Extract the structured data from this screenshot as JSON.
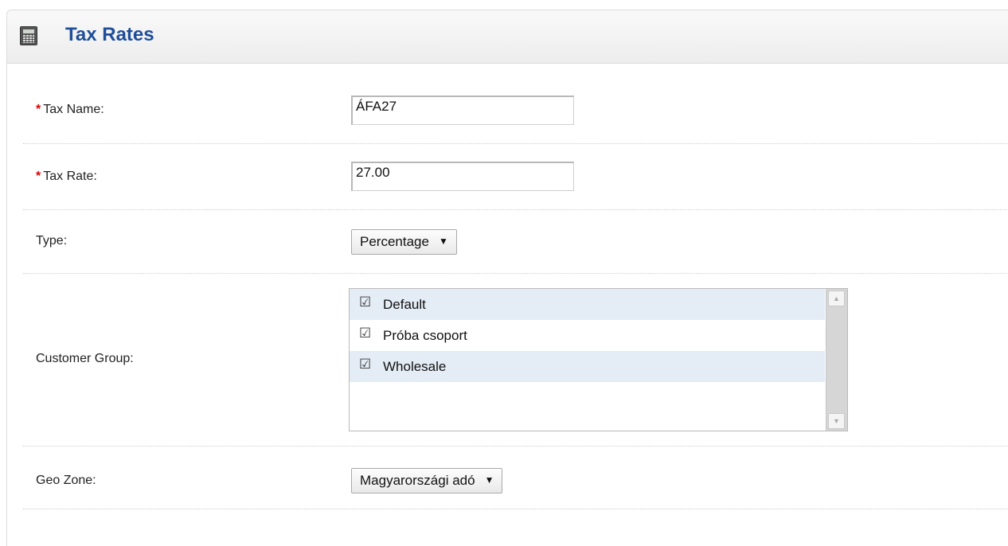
{
  "page": {
    "title": "Tax Rates",
    "icon": "calculator-icon"
  },
  "form": {
    "required_marker": "*",
    "tax_name": {
      "label": "Tax Name:",
      "value": "ÁFA27",
      "required": true
    },
    "tax_rate": {
      "label": "Tax Rate:",
      "value": "27.00",
      "required": true
    },
    "type": {
      "label": "Type:",
      "selected": "Percentage",
      "arrow": "▼"
    },
    "customer_group": {
      "label": "Customer Group:",
      "check_glyph": "☑",
      "items": [
        {
          "label": "Default",
          "checked": true
        },
        {
          "label": "Próba csoport",
          "checked": true
        },
        {
          "label": "Wholesale",
          "checked": true
        }
      ],
      "scroll_up": "▲",
      "scroll_down": "▼"
    },
    "geo_zone": {
      "label": "Geo Zone:",
      "selected": "Magyarországi adó",
      "arrow": "▼"
    }
  },
  "colors": {
    "title": "#1f4e99",
    "required": "#e00000",
    "row_stripe": "#e4ecf5"
  }
}
